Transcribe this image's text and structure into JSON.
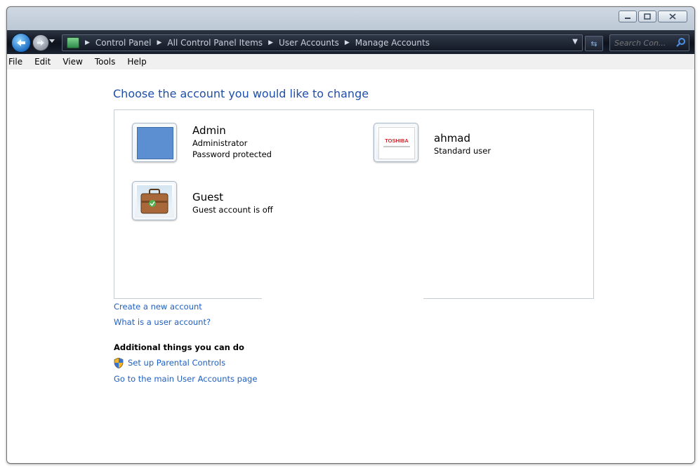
{
  "window": {
    "caption_buttons": [
      "minimize",
      "maximize",
      "close"
    ]
  },
  "address_bar": {
    "breadcrumbs": [
      "Control Panel",
      "All Control Panel Items",
      "User Accounts",
      "Manage Accounts"
    ],
    "search_placeholder": "Search Con..."
  },
  "menu": {
    "items": [
      "File",
      "Edit",
      "View",
      "Tools",
      "Help"
    ]
  },
  "main": {
    "heading": "Choose the account you would like to change",
    "accounts": [
      {
        "name": "Admin",
        "lines": [
          "Administrator",
          "Password protected"
        ],
        "picture": "blue-square"
      },
      {
        "name": "ahmad",
        "lines": [
          "Standard user"
        ],
        "picture": "toshiba-logo",
        "picture_text": "TOSHIBA"
      },
      {
        "name": "Guest",
        "lines": [
          "Guest account is off"
        ],
        "picture": "briefcase"
      }
    ],
    "links": {
      "create_account": "Create a new account",
      "what_is": "What is a user account?"
    },
    "additional": {
      "title": "Additional things you can do",
      "parental_controls": "Set up Parental Controls",
      "main_page": "Go to the main User Accounts page"
    }
  },
  "colors": {
    "link": "#1f5fbf",
    "heading": "#1e4fa8",
    "admin_picture": "#5b8fd1"
  }
}
